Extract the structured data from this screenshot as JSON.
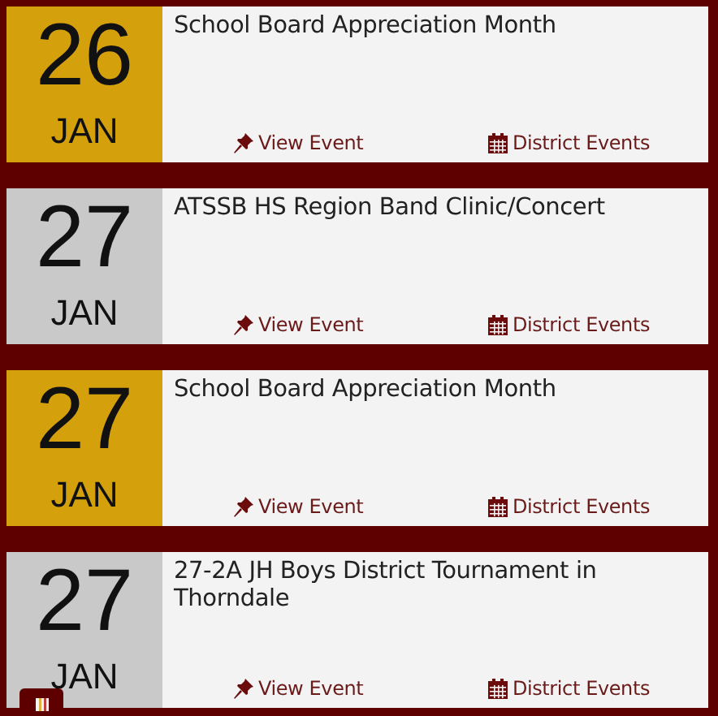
{
  "events": [
    {
      "day": "26",
      "month": "JAN",
      "color": "#d4a00b",
      "title": "School Board Appreciation Month",
      "view_link": "View Event",
      "category_link": "District Events"
    },
    {
      "day": "27",
      "month": "JAN",
      "color": "#c9c9c9",
      "title": "ATSSB HS Region Band Clinic/Concert",
      "view_link": "View Event",
      "category_link": "District Events"
    },
    {
      "day": "27",
      "month": "JAN",
      "color": "#d4a00b",
      "title": "School Board Appreciation Month",
      "view_link": "View Event",
      "category_link": "District Events"
    },
    {
      "day": "27",
      "month": "JAN",
      "color": "#c9c9c9",
      "title": "27-2A JH Boys District Tournament in Thorndale",
      "view_link": "View Event",
      "category_link": "District Events"
    }
  ]
}
